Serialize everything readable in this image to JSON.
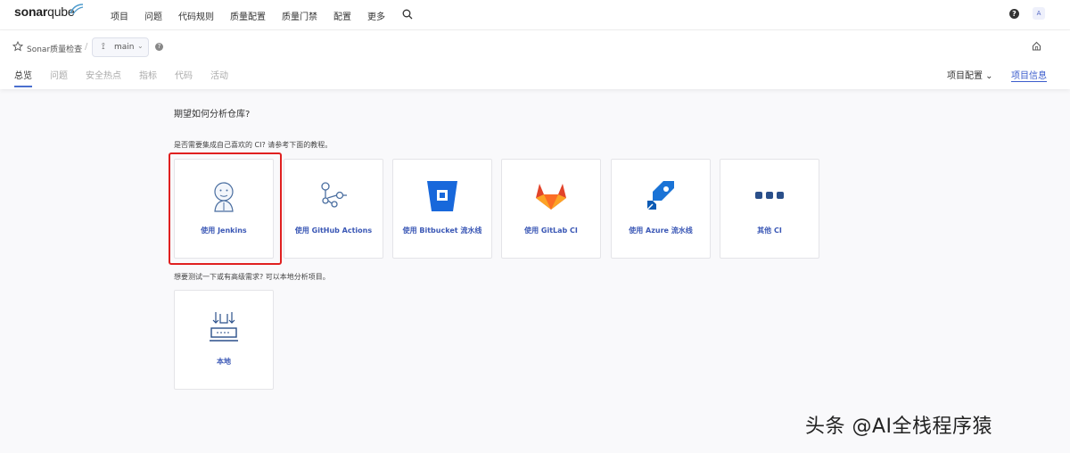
{
  "topbar": {
    "logo_main": "sonar",
    "logo_sub": "qube",
    "nav": [
      "项目",
      "问题",
      "代码规则",
      "质量配置",
      "质量门禁",
      "配置",
      "更多"
    ],
    "help": "?",
    "avatar": "A"
  },
  "project": {
    "name": "Sonar质量检查",
    "separator": "/",
    "branch": "main",
    "branch_help": "?",
    "tabs": [
      "总览",
      "问题",
      "安全热点",
      "指标",
      "代码",
      "活动"
    ],
    "config": "项目配置 ⌄",
    "info": "项目信息"
  },
  "main": {
    "question": "期望如何分析仓库?",
    "ci_prompt": "是否需要集成自己喜欢的 CI? 请参考下面的教程。",
    "cards": [
      {
        "label": "使用 Jenkins",
        "icon": "jenkins-icon"
      },
      {
        "label": "使用 GitHub Actions",
        "icon": "github-actions-icon"
      },
      {
        "label": "使用 Bitbucket 流水线",
        "icon": "bitbucket-icon"
      },
      {
        "label": "使用 GitLab CI",
        "icon": "gitlab-icon"
      },
      {
        "label": "使用 Azure 流水线",
        "icon": "azure-icon"
      },
      {
        "label": "其他 CI",
        "icon": "dots-icon"
      }
    ],
    "local_prompt": "想要测试一下或有高级需求? 可以本地分析项目。",
    "local_card": {
      "label": "本地",
      "icon": "local-icon"
    }
  },
  "watermark": "头条 @AI全栈程序猿",
  "colors": {
    "accent": "#3b5ccc",
    "highlight": "#e02020"
  }
}
